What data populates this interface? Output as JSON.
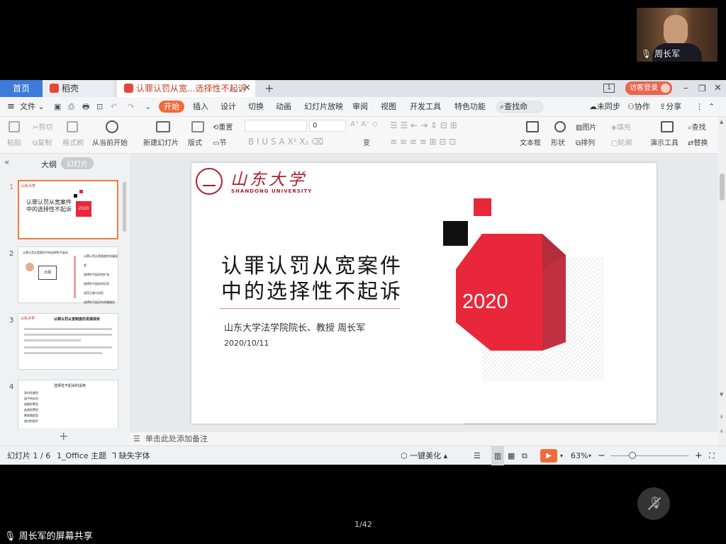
{
  "meeting": {
    "participant_name": "周长军",
    "share_label": "周长军的屏幕共享",
    "page_counter": "1/42"
  },
  "tabs": [
    {
      "label": "首页"
    },
    {
      "label": "稻壳"
    },
    {
      "label": "认罪认罚从宽...选择性不起诉"
    }
  ],
  "titlebar": {
    "window_count": "1",
    "login_label": "访客登录"
  },
  "menu": [
    "文件",
    "开始",
    "插入",
    "设计",
    "切换",
    "动画",
    "幻灯片放映",
    "审阅",
    "视图",
    "开发工具",
    "特色功能"
  ],
  "menu_right": {
    "search_placeholder": "查找命令...",
    "sync": "未同步",
    "collab": "协作",
    "share": "分享"
  },
  "ribbon": {
    "paste": "粘贴",
    "cut": "剪切",
    "copy": "复制",
    "format_painter": "格式刷",
    "from_current": "从当前开始",
    "new_slide": "新建幻灯片",
    "layout": "版式",
    "section": "节",
    "reset": "重置",
    "font_size": "0",
    "textbox": "文本框",
    "shape": "形状",
    "picture": "图片",
    "fill": "填充",
    "arrange": "排列",
    "outline": "轮廓",
    "present_tool": "演示工具",
    "find": "查找",
    "replace": "替换"
  },
  "panel": {
    "outline_tab": "大纲",
    "slides_tab": "幻灯片",
    "thumb_numbers": [
      "1",
      "2",
      "3",
      "4"
    ],
    "thumb1_title_1": "认罪认罚从宽案件",
    "thumb1_title_2": "中的选择性不起诉",
    "thumb1_year": "2020",
    "thumb2_title": "认罪认罚从宽案件中的选择性不起诉",
    "thumb2_center": "大纲",
    "thumb2_items": [
      "认罪认罚从宽制度的发展现状",
      "选择性不起诉的扩张",
      "选择性不起诉的反思",
      "适用之难与风险",
      "选择性不起诉的完善路径"
    ],
    "thumb3_title": "认罪认罚从宽制度的发展现状",
    "thumb4_title": "选择性不起诉的适用",
    "thumb4_items": [
      "身份优越型",
      "因不明去向",
      "轻微犯罪型",
      "疾病犯罪型",
      "教育隔离型",
      "相对附条件"
    ]
  },
  "slide": {
    "university_cn": "山东大学",
    "university_en": "SHANDONG UNIVERSITY",
    "title_line1": "认罪认罚从宽案件",
    "title_line2": "中的选择性不起诉",
    "author": "山东大学法学院院长、教授  周长军",
    "date": "2020/10/11",
    "year": "2020"
  },
  "notes_placeholder": "单击此处添加备注",
  "status": {
    "slide_count": "幻灯片 1 / 6",
    "theme": "1_Office 主题",
    "missing_font": "缺失字体",
    "beautify": "一键美化",
    "zoom": "63%"
  },
  "colors": {
    "accent_red": "#e8283a",
    "dark_red": "#b01e2c",
    "brand_blue": "#3d7bd9",
    "wps_orange": "#f06a3a"
  }
}
